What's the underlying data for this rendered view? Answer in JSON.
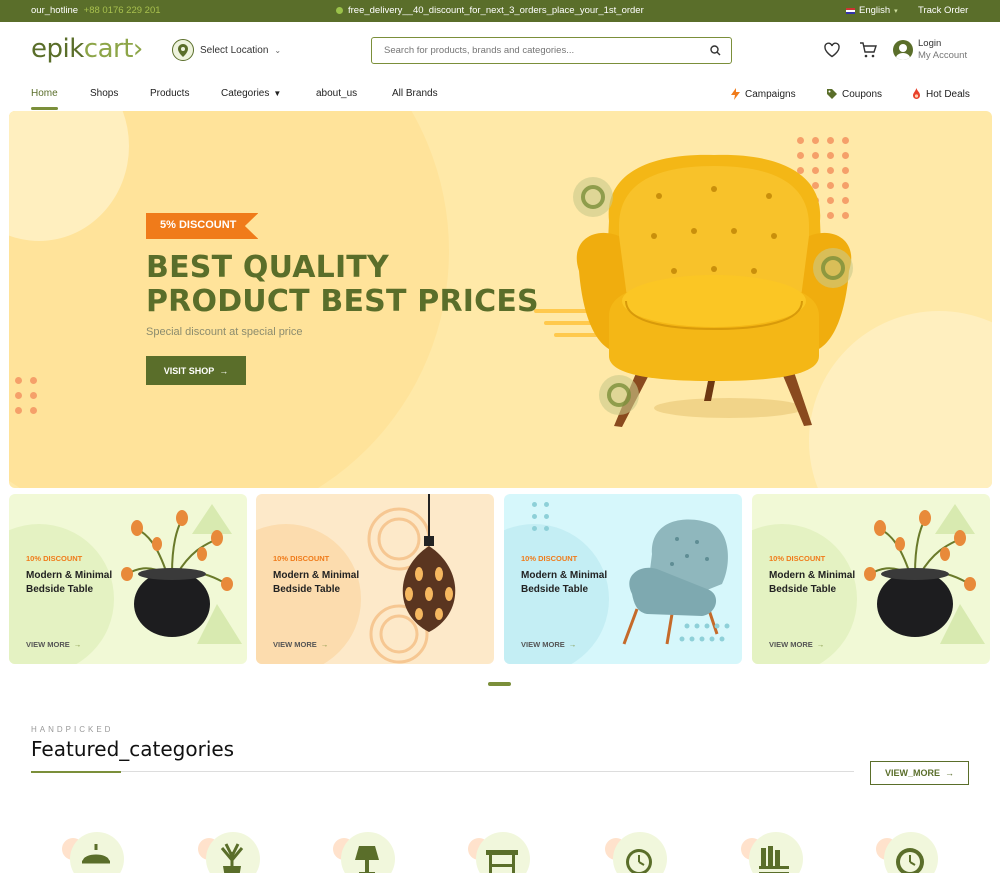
{
  "topbar": {
    "hotline_label": "our_hotline",
    "hotline_number": "+88 0176 229 201",
    "promo_text": "free_delivery__40_discount_for_next_3_orders_place_your_1st_order",
    "language": "English",
    "track_order": "Track Order"
  },
  "header": {
    "logo_main": "epik",
    "logo_accent": "cart",
    "location_label": "Select Location",
    "search_placeholder": "Search for products, brands and categories...",
    "login_label": "Login",
    "account_label": "My Account"
  },
  "nav": {
    "items": [
      "Home",
      "Shops",
      "Products",
      "Categories",
      "about_us",
      "All Brands"
    ],
    "right_items": [
      "Campaigns",
      "Coupons",
      "Hot Deals"
    ]
  },
  "hero": {
    "badge": "5% DISCOUNT",
    "title_line1": "BEST QUALITY",
    "title_line2": "PRODUCT BEST PRICES",
    "subtitle": "Special discount at special price",
    "button": "VISIT SHOP"
  },
  "promo_cards": [
    {
      "discount": "10% DISCOUNT",
      "title_line1": "Modern & Minimal",
      "title_line2": "Bedside Table",
      "link": "VIEW MORE",
      "bg": "#f1f9d6",
      "circle": "#e4f2c2",
      "art": "plant-pot"
    },
    {
      "discount": "10% DISCOUNT",
      "title_line1": "Modern & Minimal",
      "title_line2": "Bedside Table",
      "link": "VIEW MORE",
      "bg": "#fde9c9",
      "circle": "#fcdcae",
      "art": "pendant-lamp"
    },
    {
      "discount": "10% DISCOUNT",
      "title_line1": "Modern & Minimal",
      "title_line2": "Bedside Table",
      "link": "VIEW MORE",
      "bg": "#d6f7fb",
      "circle": "#c4eef4",
      "art": "armchair-blue"
    },
    {
      "discount": "10% DISCOUNT",
      "title_line1": "Modern & Minimal",
      "title_line2": "Bedside Table",
      "link": "VIEW MORE",
      "bg": "#f1f9d6",
      "circle": "#e4f2c2",
      "art": "plant-pot"
    }
  ],
  "featured": {
    "eyebrow": "HANDPICKED",
    "title": "Featured_categories",
    "view_more": "VIEW_MORE",
    "category_icons": [
      "lamp-icon",
      "plant-icon",
      "table-lamp-icon",
      "table-icon",
      "clock-icon",
      "bookshelf-icon",
      "wall-clock-icon"
    ]
  },
  "colors": {
    "brand": "#5a6e2a",
    "accent_orange": "#f07b1a",
    "hero_bg": "#ffe9a8"
  }
}
